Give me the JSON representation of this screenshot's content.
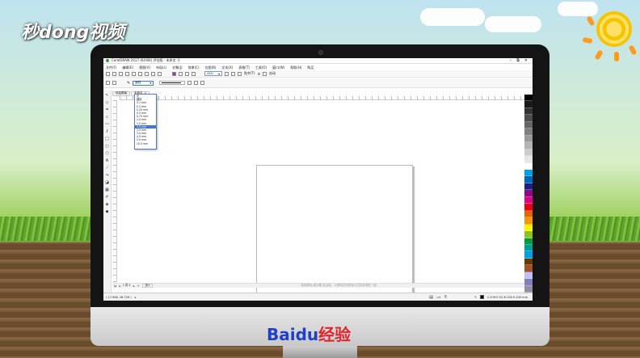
{
  "watermark": "秒dong视频",
  "brand": {
    "baidu_text": "Bai",
    "baidu_du": "du",
    "baidu_suffix": "经验"
  },
  "window": {
    "title": "CorelDRAW 2017 (64-Bit) 评估版 - 未命名 -1",
    "minimize": "–",
    "restore": "⧉",
    "close": "✕"
  },
  "menu": [
    "文件(F)",
    "编辑(E)",
    "视图(V)",
    "布局(L)",
    "对象(J)",
    "效果(C)",
    "位图(B)",
    "文本(X)",
    "表格(T)",
    "工具(O)",
    "窗口(W)",
    "帮助(H)",
    "购买"
  ],
  "standard_toolbar": {
    "zoom": "42%",
    "snap_label": "贴齐(T)",
    "launch_label": "启动"
  },
  "property_bar": {
    "outline_width": "细线"
  },
  "tabs": [
    "欢迎屏幕",
    "未命名 -1"
  ],
  "outline_width_options": [
    {
      "label": "无",
      "selected": false
    },
    {
      "label": "细线",
      "selected": false
    },
    {
      "label": "0.1 mm",
      "selected": false
    },
    {
      "label": "0.2 mm",
      "selected": false
    },
    {
      "label": "0.25 mm",
      "selected": false
    },
    {
      "label": "0.5 mm",
      "selected": false
    },
    {
      "label": "0.75 mm",
      "selected": false
    },
    {
      "label": "1.0 mm",
      "selected": false
    },
    {
      "label": "1.5 mm",
      "selected": false
    },
    {
      "label": "2.0 mm",
      "selected": true
    },
    {
      "label": "2.5 mm",
      "selected": false
    },
    {
      "label": "3.0 mm",
      "selected": false
    },
    {
      "label": "4.0 mm",
      "selected": false
    },
    {
      "label": "5.0 mm",
      "selected": false
    },
    {
      "label": "10.0 mm",
      "selected": false
    }
  ],
  "pagebar": {
    "page_count": "1 的 1",
    "page_tab": "页1",
    "hint": "拖放颜色(或对象)至此处，以便将这些颜色与文档存储在一起"
  },
  "statusbar": {
    "coords": "( 17.946, 26.729 )",
    "fill_label": "无",
    "outline_readout": "C:0 M:0 Y:0 K:100  0.200 mm"
  },
  "palette_colors": [
    "#000000",
    "#1a1a1a",
    "#333333",
    "#4d4d4d",
    "#666666",
    "#808080",
    "#999999",
    "#b3b3b3",
    "#cccccc",
    "#e6e6e6",
    "#ffffff",
    "#00a0e9",
    "#0068b7",
    "#1d2088",
    "#920783",
    "#e4007f",
    "#e60012",
    "#eb6100",
    "#f39800",
    "#fff100",
    "#8fc31f",
    "#009944",
    "#009e96",
    "#00a0e9",
    "#6a3906",
    "#a0522d",
    "#c0c0ff",
    "#8080c0",
    "#9090a0"
  ]
}
